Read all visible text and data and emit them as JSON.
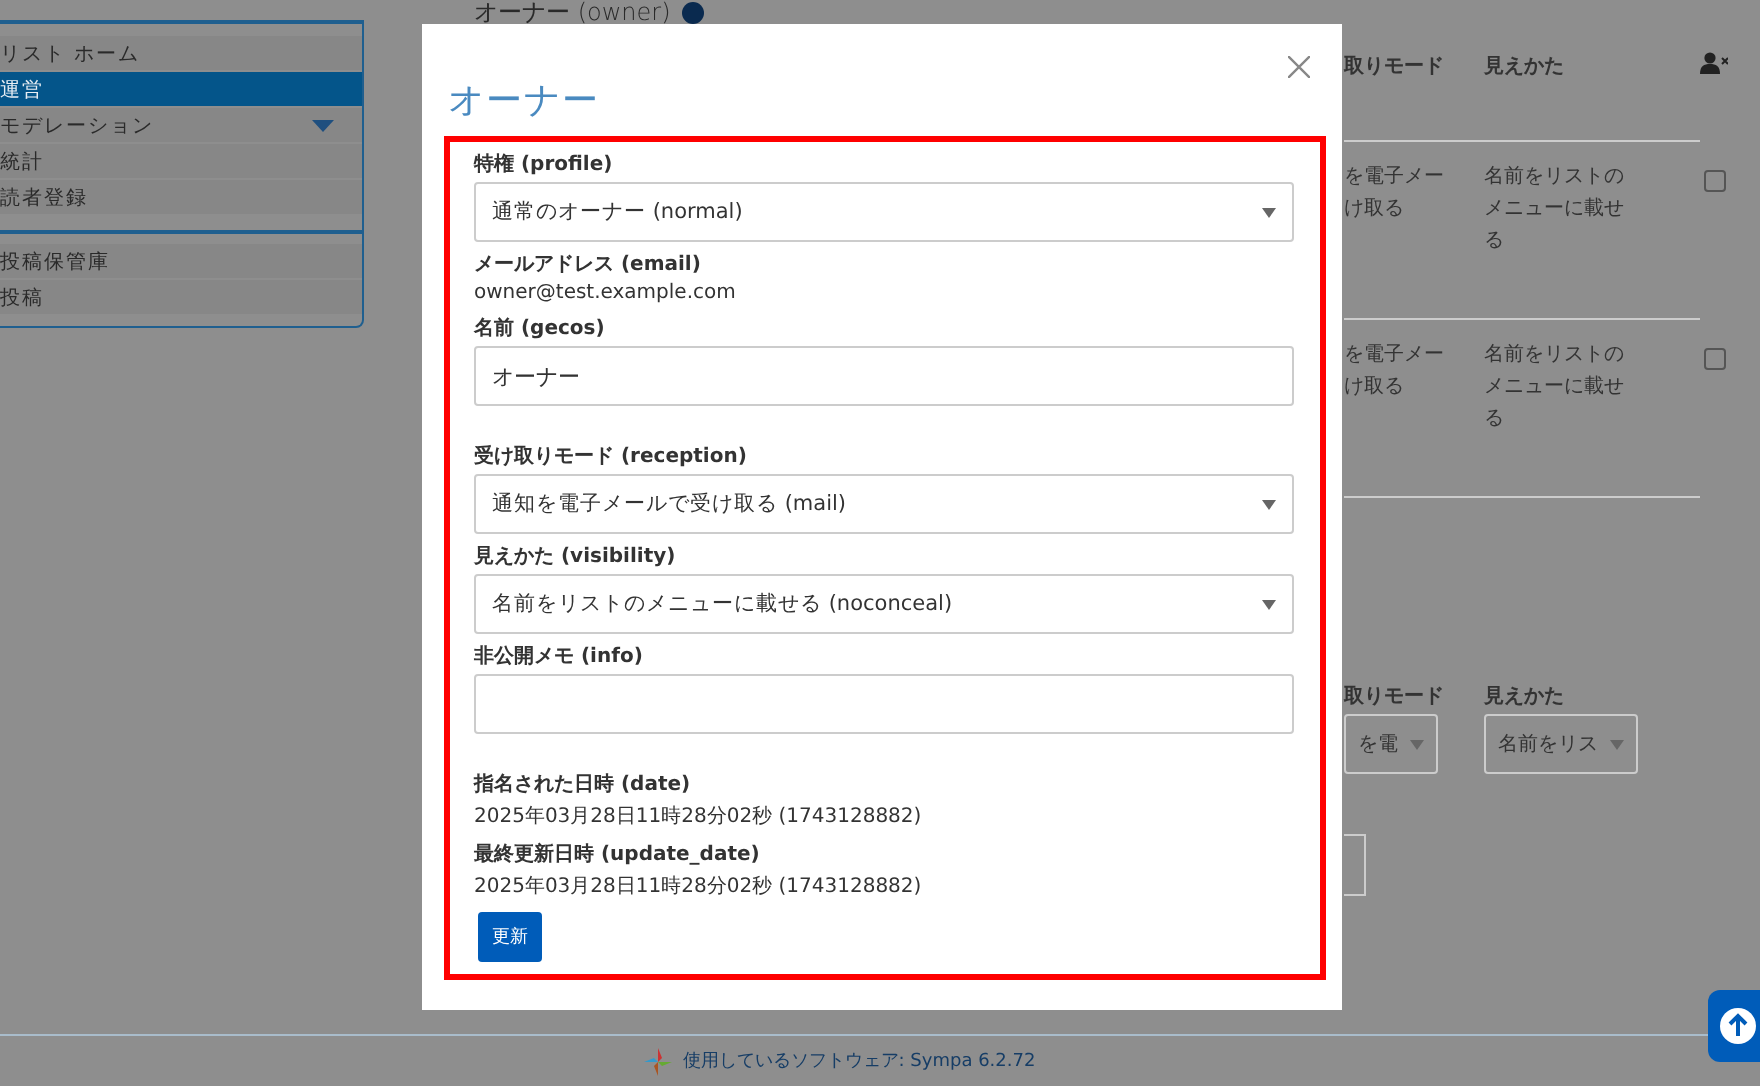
{
  "sidebar": {
    "groups": [
      [
        {
          "label": "リスト ホーム",
          "selected": false,
          "expandable": false
        },
        {
          "label": "運営",
          "selected": true,
          "expandable": false
        },
        {
          "label": "モデレーション",
          "selected": false,
          "expandable": true
        },
        {
          "label": "統計",
          "selected": false,
          "expandable": false
        },
        {
          "label": "読者登録",
          "selected": false,
          "expandable": false
        }
      ],
      [
        {
          "label": "投稿保管庫",
          "selected": false,
          "expandable": false
        },
        {
          "label": "投稿",
          "selected": false,
          "expandable": false
        }
      ]
    ]
  },
  "page_heading": "オーナー (owner)",
  "members_table": {
    "columns": [
      "取りモード",
      "見えかた"
    ],
    "rows": [
      {
        "reception": [
          "を電子メー",
          "け取る"
        ],
        "visibility": "名前をリストのメニューに載せる",
        "checked": false
      },
      {
        "reception": [
          "を電子メー",
          "け取る"
        ],
        "visibility": "名前をリストのメニューに載せる",
        "checked": false
      }
    ]
  },
  "add_form": {
    "columns": [
      "取りモード",
      "見えかた"
    ],
    "selects": [
      "を電",
      "名前をリス"
    ]
  },
  "modal": {
    "title": "オーナー",
    "fields": [
      {
        "kind": "select",
        "label": "特権 (profile)",
        "value": "通常のオーナー (normal)"
      },
      {
        "kind": "text",
        "label": "メールアドレス (email)",
        "value": "owner@test.example.com"
      },
      {
        "kind": "input",
        "label": "名前 (gecos)",
        "value": "オーナー"
      },
      {
        "kind": "select",
        "label": "受け取りモード (reception)",
        "value": "通知を電子メールで受け取る (mail)"
      },
      {
        "kind": "select",
        "label": "見えかた (visibility)",
        "value": "名前をリストのメニューに載せる (noconceal)"
      },
      {
        "kind": "input",
        "label": "非公開メモ (info)"
      },
      {
        "kind": "text",
        "label": "指名された日時 (date)",
        "value": "2025年03月28日11時28分02秒 (1743128882)"
      },
      {
        "kind": "text",
        "label": "最終更新日時 (update_date)",
        "value": "2025年03月28日11時28分02秒 (1743128882)"
      }
    ],
    "submit": "更新"
  },
  "footer": {
    "text": "使用しているソフトウェア: Sympa 6.2.72"
  }
}
